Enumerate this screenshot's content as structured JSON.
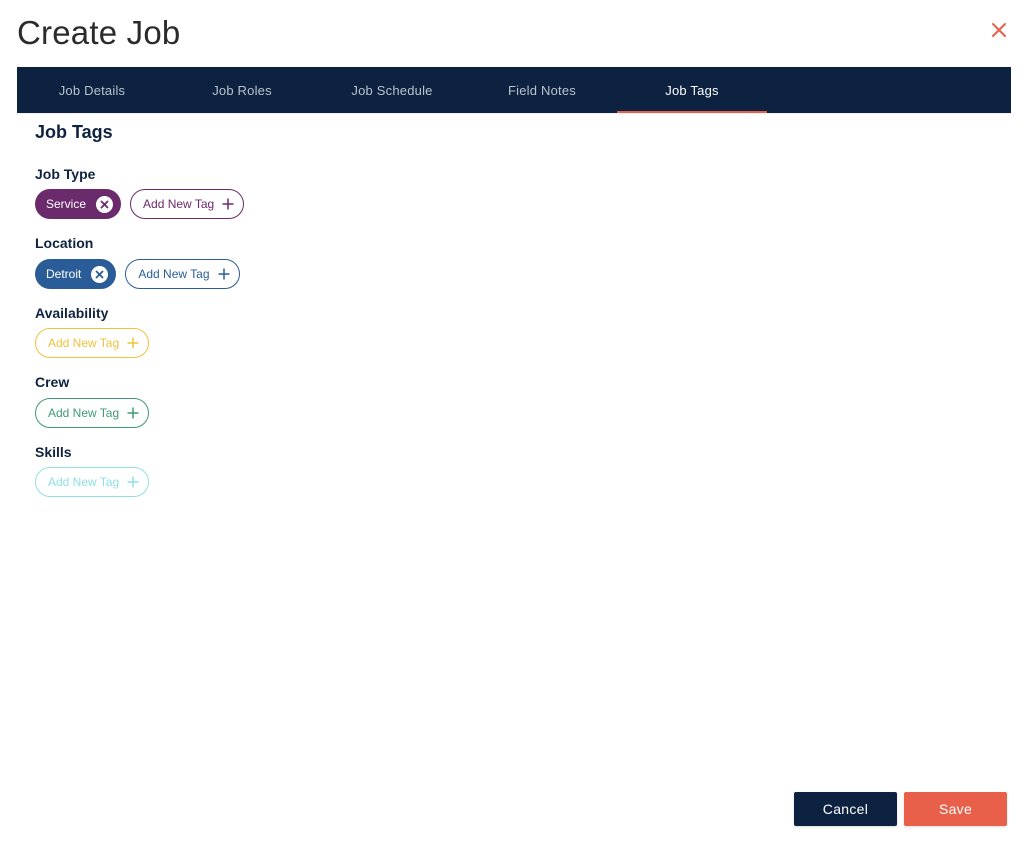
{
  "title": "Create Job",
  "close_icon": "close-icon",
  "tabs": [
    {
      "label": "Job Details",
      "active": false
    },
    {
      "label": "Job Roles",
      "active": false
    },
    {
      "label": "Job Schedule",
      "active": false
    },
    {
      "label": "Field Notes",
      "active": false
    },
    {
      "label": "Job Tags",
      "active": true
    }
  ],
  "section_heading": "Job Tags",
  "groups": [
    {
      "label": "Job Type",
      "color": "#6b2a6b",
      "tags": [
        "Service"
      ],
      "add_label": "Add New Tag"
    },
    {
      "label": "Location",
      "color": "#2a5d97",
      "tags": [
        "Detroit"
      ],
      "add_label": "Add New Tag"
    },
    {
      "label": "Availability",
      "color": "#f0c23b",
      "tags": [],
      "add_label": "Add New Tag"
    },
    {
      "label": "Crew",
      "color": "#3f9a72",
      "tags": [],
      "add_label": "Add New Tag"
    },
    {
      "label": "Skills",
      "color": "#8fe0e6",
      "tags": [],
      "add_label": "Add New Tag"
    }
  ],
  "footer": {
    "cancel_label": "Cancel",
    "save_label": "Save"
  },
  "colors": {
    "navy": "#0d2240",
    "accent": "#e8604a"
  }
}
